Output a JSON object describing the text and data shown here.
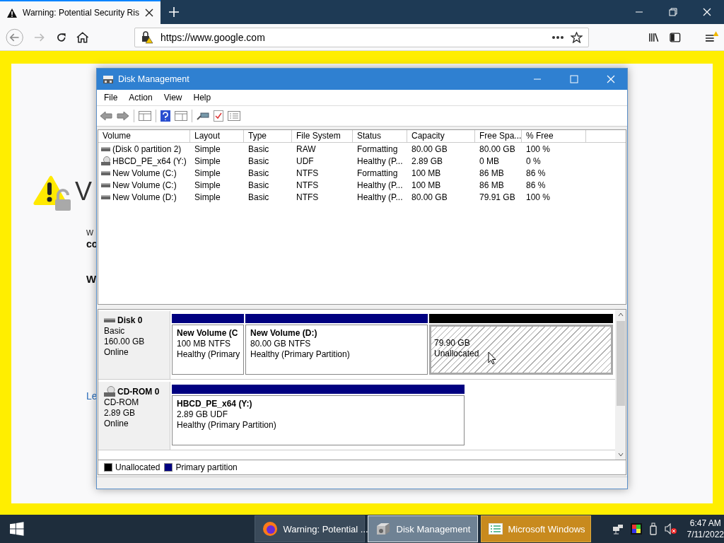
{
  "browser": {
    "tab": {
      "title": "Warning: Potential Security Ris"
    },
    "url": "https://www.google.com"
  },
  "background_page": {
    "heading": "V",
    "line_1": "w",
    "line_2": "co",
    "line_3": "W",
    "link": "Le"
  },
  "window": {
    "title": "Disk Management",
    "menu": [
      "File",
      "Action",
      "View",
      "Help"
    ],
    "table": {
      "columns": [
        "Volume",
        "Layout",
        "Type",
        "File System",
        "Status",
        "Capacity",
        "Free Spa...",
        "% Free"
      ],
      "rows": [
        {
          "kind": "disk",
          "cells": [
            "(Disk 0 partition 2)",
            "Simple",
            "Basic",
            "RAW",
            "Formatting",
            "80.00 GB",
            "80.00 GB",
            "100 %"
          ]
        },
        {
          "kind": "cd",
          "cells": [
            "HBCD_PE_x64 (Y:)",
            "Simple",
            "Basic",
            "UDF",
            "Healthy (P...",
            "2.89 GB",
            "0 MB",
            "0 %"
          ]
        },
        {
          "kind": "disk",
          "cells": [
            "New Volume (C:)",
            "Simple",
            "Basic",
            "NTFS",
            "Formatting",
            "100 MB",
            "86 MB",
            "86 %"
          ]
        },
        {
          "kind": "disk",
          "cells": [
            "New Volume (C:)",
            "Simple",
            "Basic",
            "NTFS",
            "Healthy (P...",
            "100 MB",
            "86 MB",
            "86 %"
          ]
        },
        {
          "kind": "disk",
          "cells": [
            "New Volume (D:)",
            "Simple",
            "Basic",
            "NTFS",
            "Healthy (P...",
            "80.00 GB",
            "79.91 GB",
            "100 %"
          ]
        }
      ]
    },
    "disks": [
      {
        "kind": "disk",
        "name": "Disk 0",
        "type": "Basic",
        "size": "160.00 GB",
        "status": "Online",
        "partitions": [
          {
            "kind": "primary",
            "selected": false,
            "name": "New Volume  (C",
            "size": "100 MB NTFS",
            "status": "Healthy (Primary"
          },
          {
            "kind": "primary",
            "selected": false,
            "name": "New Volume  (D:)",
            "size": "80.00 GB NTFS",
            "status": "Healthy (Primary Partition)"
          },
          {
            "kind": "unallocated",
            "selected": true,
            "size": "79.90 GB",
            "status": "Unallocated"
          }
        ]
      },
      {
        "kind": "cd",
        "name": "CD-ROM 0",
        "type": "CD-ROM",
        "size": "2.89 GB",
        "status": "Online",
        "partitions": [
          {
            "kind": "primary",
            "selected": false,
            "name": "HBCD_PE_x64  (Y:)",
            "size": "2.89 GB UDF",
            "status": "Healthy (Primary Partition)"
          }
        ]
      }
    ],
    "legend": [
      {
        "label": "Unallocated",
        "color": "#000000"
      },
      {
        "label": "Primary partition",
        "color": "#000080"
      }
    ]
  },
  "taskbar": {
    "items": [
      {
        "kind": "firefox",
        "label": "Warning: Potential ...",
        "selected": false,
        "attention": false
      },
      {
        "kind": "disk",
        "label": "Disk Management",
        "selected": true,
        "attention": false
      },
      {
        "kind": "list",
        "label": "Microsoft Windows",
        "selected": false,
        "attention": true
      }
    ],
    "time": "6:47 AM",
    "date": "7/11/2022"
  }
}
